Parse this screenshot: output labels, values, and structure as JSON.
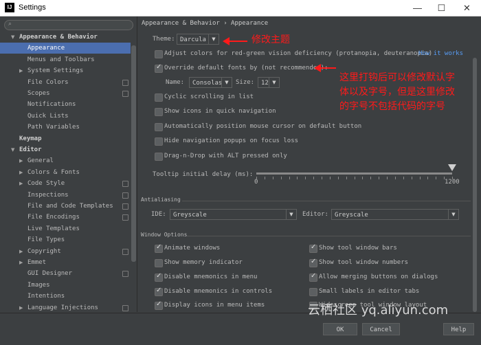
{
  "window": {
    "title": "Settings",
    "app_icon": "IJ"
  },
  "search": {
    "placeholder": ""
  },
  "tree": [
    {
      "label": "Appearance & Behavior",
      "arrow": "▼",
      "bold": true
    },
    {
      "label": "Appearance",
      "selected": true
    },
    {
      "label": "Menus and Toolbars"
    },
    {
      "label": "System Settings",
      "arrow": "▶"
    },
    {
      "label": "File Colors",
      "proj": true
    },
    {
      "label": "Scopes",
      "proj": true
    },
    {
      "label": "Notifications"
    },
    {
      "label": "Quick Lists"
    },
    {
      "label": "Path Variables"
    },
    {
      "label": "Keymap",
      "bold": true
    },
    {
      "label": "Editor",
      "arrow": "▼",
      "bold": true
    },
    {
      "label": "General",
      "arrow": "▶"
    },
    {
      "label": "Colors & Fonts",
      "arrow": "▶"
    },
    {
      "label": "Code Style",
      "arrow": "▶",
      "proj": true
    },
    {
      "label": "Inspections",
      "proj": true
    },
    {
      "label": "File and Code Templates",
      "proj": true
    },
    {
      "label": "File Encodings",
      "proj": true
    },
    {
      "label": "Live Templates"
    },
    {
      "label": "File Types"
    },
    {
      "label": "Copyright",
      "arrow": "▶",
      "proj": true
    },
    {
      "label": "Emmet",
      "arrow": "▶"
    },
    {
      "label": "GUI Designer",
      "proj": true
    },
    {
      "label": "Images"
    },
    {
      "label": "Intentions"
    },
    {
      "label": "Language Injections",
      "arrow": "▶",
      "proj": true
    }
  ],
  "content": {
    "breadcrumb": "Appearance & Behavior › Appearance",
    "theme_label": "Theme:",
    "theme_value": "Darcula",
    "adjust_colors": "Adjust colors for red-green vision deficiency (protanopia, deuteranopia)",
    "how_it_works": "How it works",
    "override_fonts": "Override default fonts by (not recommended):",
    "name_label": "Name:",
    "name_value": "Consolas",
    "size_label": "Size:",
    "size_value": "12",
    "cyclic_scrolling": "Cyclic scrolling in list",
    "show_icons_nav": "Show icons in quick navigation",
    "auto_position": "Automatically position mouse cursor on default button",
    "hide_nav_popups": "Hide navigation popups on focus loss",
    "drag_n_drop": "Drag-n-Drop with ALT pressed only",
    "tooltip_label": "Tooltip initial delay (ms):",
    "tooltip_min": "0",
    "tooltip_max": "1200",
    "tooltip_value": 1200,
    "antialiasing_title": "Antialiasing",
    "ide_label": "IDE:",
    "ide_value": "Greyscale",
    "editor_label": "Editor:",
    "editor_value": "Greyscale",
    "window_options_title": "Window Options",
    "animate_windows": "Animate windows",
    "show_memory": "Show memory indicator",
    "disable_mnemonics_menu": "Disable mnemonics in menu",
    "disable_mnemonics_controls": "Disable mnemonics in controls",
    "display_icons_menu": "Display icons in menu items",
    "show_tool_bars": "Show tool window bars",
    "show_tool_numbers": "Show tool window numbers",
    "allow_merging": "Allow merging buttons on dialogs",
    "small_labels": "Small labels in editor tabs",
    "widescreen_layout": "Widescreen tool window layout"
  },
  "annotations": {
    "theme_note": "修改主题",
    "font_note_lines": [
      "这里打钩后可以修改默认字",
      "体以及字号，但是这里修改",
      "的字号不包括代码的字号"
    ],
    "color": "#ff1a1a"
  },
  "footer": {
    "ok": "OK",
    "cancel": "Cancel",
    "help": "Help"
  },
  "watermark": "云栖社区 yq.aliyun.com"
}
